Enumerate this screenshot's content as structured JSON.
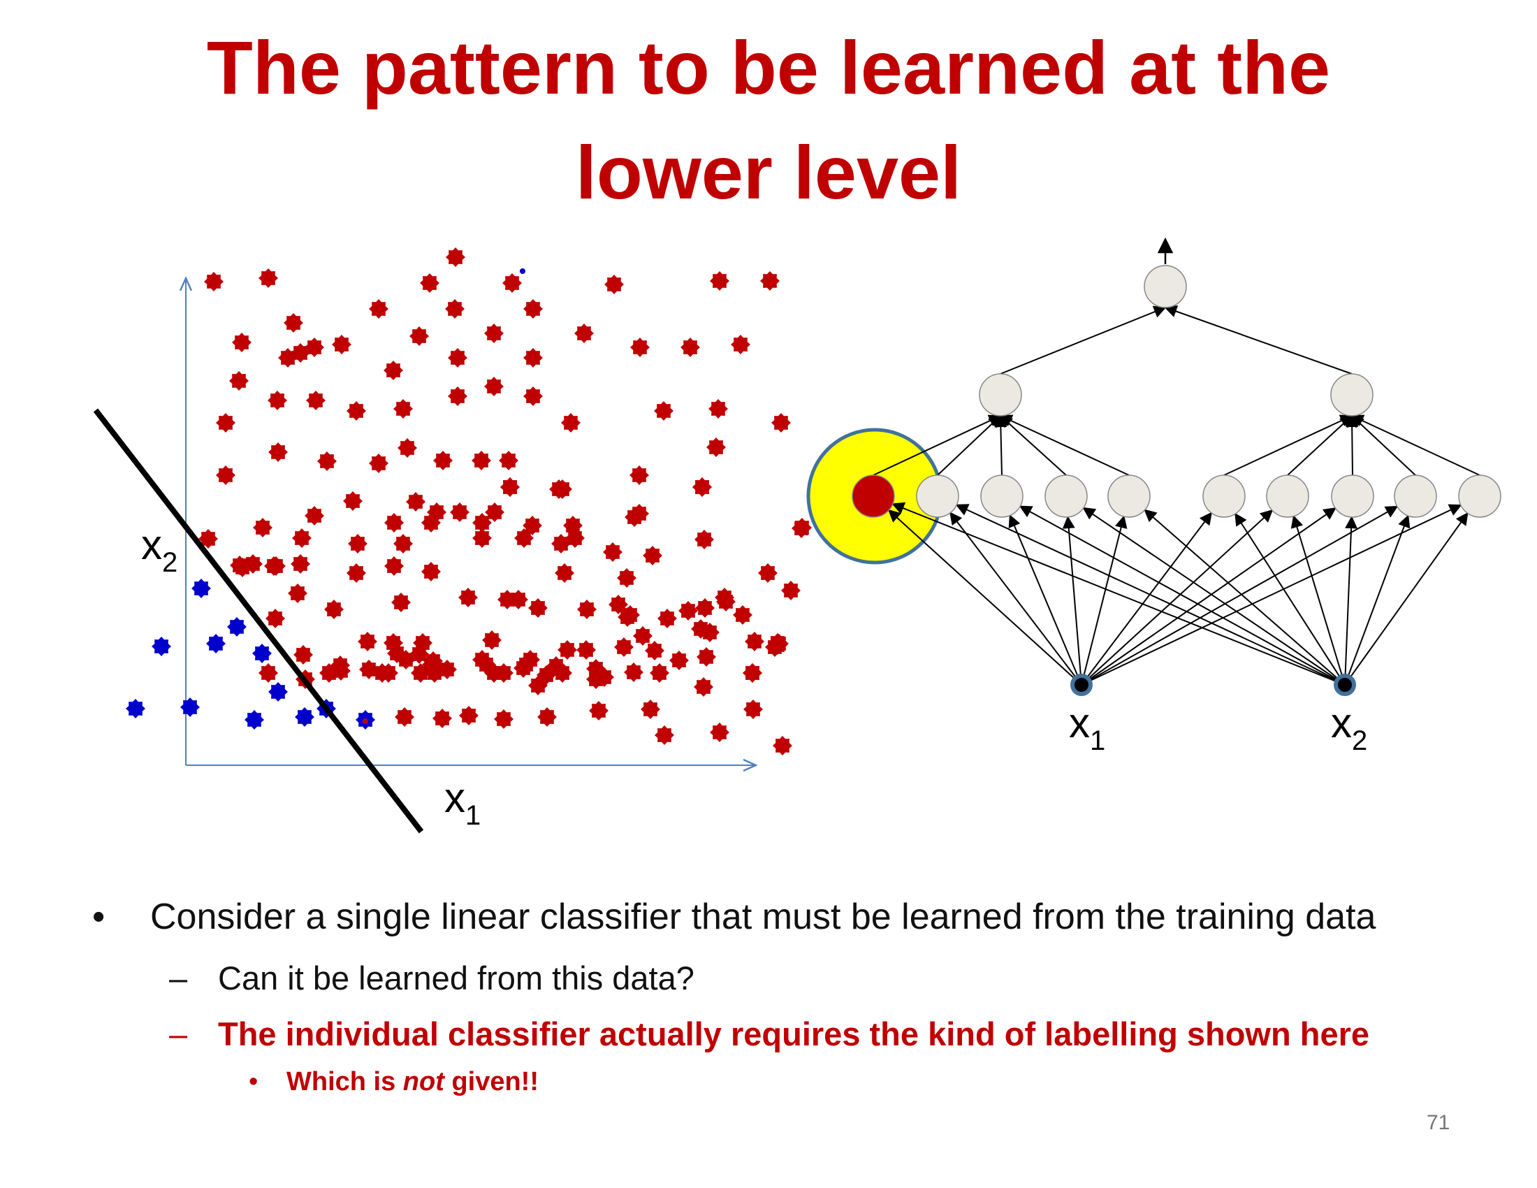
{
  "slide": {
    "title_line1": "The pattern to be learned at the",
    "title_line2": "lower level",
    "page_number": "71"
  },
  "scatter_plot": {
    "x_axis_label": "x",
    "x_axis_subscript": "1",
    "y_axis_label": "x",
    "y_axis_subscript": "2",
    "positive_color": "#c00000",
    "negative_color": "#0000cc"
  },
  "network": {
    "input1_label": "x",
    "input1_subscript": "1",
    "input2_label": "x",
    "input2_subscript": "2",
    "node_fill": "#ebe9e1",
    "highlight_fill": "#ffff00",
    "highlight_node_fill": "#c00000"
  },
  "bullets": {
    "level1_marker": "•",
    "level1_text": "Consider a single linear classifier that must be learned from the training data",
    "level2_marker": "–",
    "level2_text": "Can it be learned from this data?",
    "level3_marker": "–",
    "level3_text": "The individual classifier actually requires the kind of labelling shown here",
    "level4_marker": "•",
    "level4_text_before": "Which is ",
    "level4_text_italic": "not",
    "level4_text_after": " given!!"
  }
}
